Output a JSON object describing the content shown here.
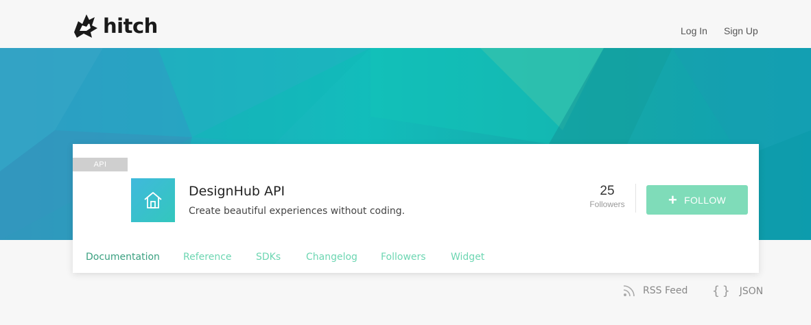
{
  "header": {
    "logo_text": "hitch",
    "nav": {
      "login": "Log In",
      "signup": "Sign Up"
    }
  },
  "card": {
    "badge": "API",
    "icon": "home-icon",
    "title": "DesignHub API",
    "description": "Create beautiful experiences without coding.",
    "followers_count": "25",
    "followers_label": "Followers",
    "follow_button": "FOLLOW",
    "tabs": [
      {
        "label": "Documentation",
        "active": true
      },
      {
        "label": "Reference"
      },
      {
        "label": "SDKs"
      },
      {
        "label": "Changelog"
      },
      {
        "label": "Followers"
      },
      {
        "label": "Widget"
      }
    ]
  },
  "footer_links": {
    "rss": "RSS Feed",
    "json": "JSON"
  },
  "colors": {
    "accent": "#7fdcb9",
    "tab_text": "#6dd6b2",
    "hero_primary": "#14b3b3"
  }
}
